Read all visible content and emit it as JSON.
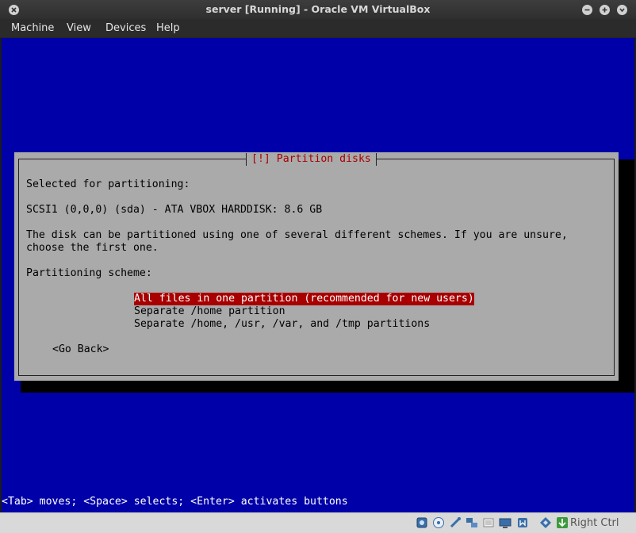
{
  "window": {
    "title": "server [Running] - Oracle VM VirtualBox"
  },
  "menu": {
    "items": [
      "Machine",
      "View",
      "Devices",
      "Help"
    ]
  },
  "dialog": {
    "title": "[!] Partition disks",
    "selected_label": "Selected for partitioning:",
    "disk": "SCSI1 (0,0,0) (sda) - ATA VBOX HARDDISK: 8.6 GB",
    "description_line1": "The disk can be partitioned using one of several different schemes. If you are unsure,",
    "description_line2": "choose the first one.",
    "scheme_label": "Partitioning scheme:",
    "options": [
      "All files in one partition (recommended for new users)",
      "Separate /home partition",
      "Separate /home, /usr, /var, and /tmp partitions"
    ],
    "go_back": "<Go Back>"
  },
  "status_line": "<Tab> moves; <Space> selects; <Enter> activates buttons",
  "statusbar": {
    "host_key": "Right Ctrl",
    "icons": [
      "hard-disk-icon",
      "optical-drive-icon",
      "usb-icon",
      "network-icon",
      "shared-folders-icon",
      "display-icon",
      "video-capture-icon",
      "cpu-virtualization-icon",
      "mouse-integration-icon"
    ]
  },
  "colors": {
    "screen_bg": "#0000a8",
    "dialog_bg": "#aaaaaa",
    "selection_bg": "#a80000",
    "title_fg": "#a80000"
  }
}
